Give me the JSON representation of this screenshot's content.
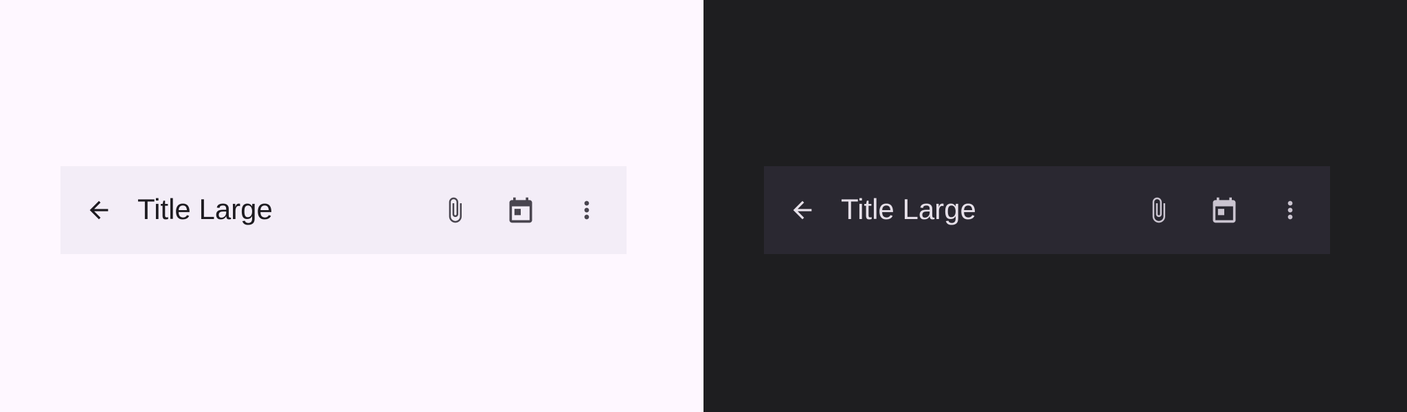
{
  "variants": [
    {
      "theme": "light",
      "page_background": "#FEF7FF",
      "bar_background": "#F3EDF7",
      "title": "Title Large",
      "title_color": "#1D1B20",
      "nav_icon": "arrow-back-icon",
      "nav_icon_color": "#1D1B20",
      "actions": [
        {
          "icon": "attach-file-icon",
          "color": "#49454F"
        },
        {
          "icon": "calendar-today-icon",
          "color": "#49454F"
        },
        {
          "icon": "more-vert-icon",
          "color": "#49454F"
        }
      ]
    },
    {
      "theme": "dark",
      "page_background": "#1E1E20",
      "bar_background": "#2A2831",
      "title": "Title Large",
      "title_color": "#E6E0E9",
      "nav_icon": "arrow-back-icon",
      "nav_icon_color": "#E6E0E9",
      "actions": [
        {
          "icon": "attach-file-icon",
          "color": "#CAC4D0"
        },
        {
          "icon": "calendar-today-icon",
          "color": "#CAC4D0"
        },
        {
          "icon": "more-vert-icon",
          "color": "#CAC4D0"
        }
      ]
    }
  ]
}
